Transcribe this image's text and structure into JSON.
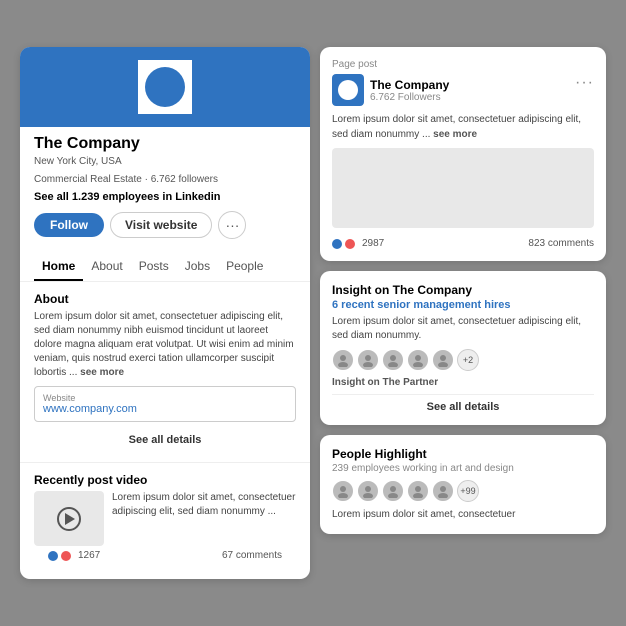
{
  "left": {
    "banner_bg": "#2f73c0",
    "company_name": "The Company",
    "company_location": "New York City, USA",
    "company_industry": "Commercial Real Estate · 6.762 followers",
    "see_employees": "See all 1.239 employees in Linkedin",
    "btn_follow": "Follow",
    "btn_visit": "Visit website",
    "nav": {
      "tabs": [
        "Home",
        "About",
        "Posts",
        "Jobs",
        "People"
      ],
      "active": "Home"
    },
    "about": {
      "title": "About",
      "text": "Lorem ipsum dolor sit amet, consectetuer adipiscing elit, sed diam nonummy nibh euismod tincidunt ut laoreet dolore magna aliquam erat volutpat. Ut wisi enim ad minim veniam, quis nostrud exerci tation ullamcorper suscipit lobortis ...",
      "see_more": "see more",
      "website_label": "Website",
      "website_url": "www.company.com",
      "see_all_details": "See all details"
    },
    "video_section": {
      "title": "Recently post video",
      "text": "Lorem ipsum dolor sit amet, consectetuer adipiscing elit, sed diam nonummy ...",
      "reaction_count": "1267",
      "comments_count": "67 comments"
    }
  },
  "right": {
    "page_post": {
      "label": "Page post",
      "company_name": "The Company",
      "followers": "6.762 Followers",
      "text": "Lorem ipsum dolor sit amet, consectetuer adipiscing elit, sed diam nonummy ... see more",
      "see_more": "see more",
      "reaction_count": "2987",
      "comments_count": "823 comments",
      "three_dots": "···"
    },
    "insight": {
      "title": "Insight on The Company",
      "subtitle": "6 recent senior management hires",
      "text": "Lorem ipsum dolor sit amet, consectetuer adipiscing elit, sed diam nonummy.",
      "plus_label": "+2",
      "partner_label": "Insight on The Partner",
      "see_all_details": "See all details"
    },
    "people_highlight": {
      "title": "People Highlight",
      "subtitle": "239 employees working in art and design",
      "plus_label": "+99",
      "text": "Lorem ipsum dolor sit amet, consectetuer"
    }
  }
}
